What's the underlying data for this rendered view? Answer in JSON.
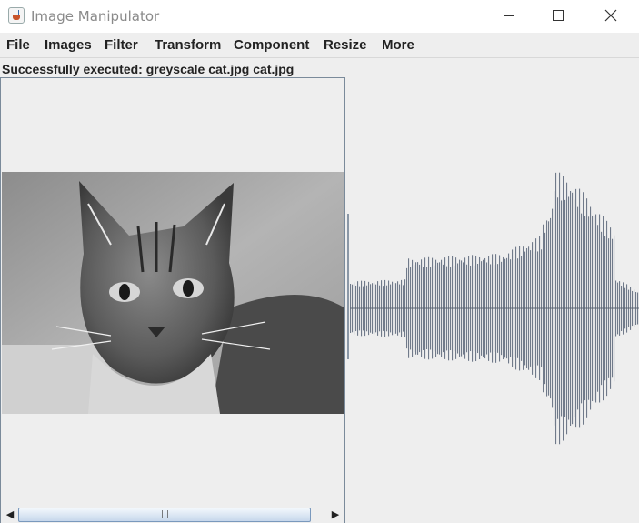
{
  "window": {
    "title": "Image Manipulator",
    "controls": {
      "minimize": "minimize-icon",
      "maximize": "maximize-icon",
      "close": "close-icon"
    }
  },
  "menu": [
    "File",
    "Images",
    "Filter",
    "Transform",
    "Component",
    "Resize",
    "More"
  ],
  "status": "Successfully executed: greyscale cat.jpg cat.jpg",
  "image_pane": {
    "image": "greyscale cat photo",
    "scrollbar": {
      "left_arrow": "◀",
      "right_arrow": "▶",
      "thumb_grip": "|||"
    }
  },
  "colors": {
    "waveform": "#707a8a",
    "menubar": "#eeeeee",
    "border": "#7a8a9a"
  }
}
